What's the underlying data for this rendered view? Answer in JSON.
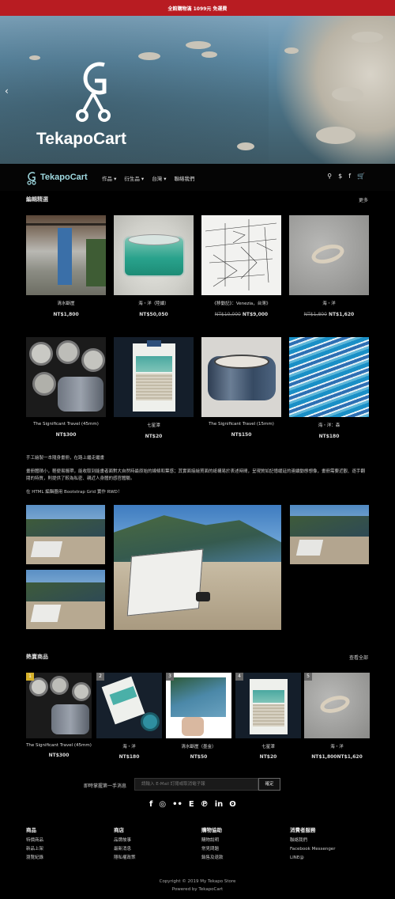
{
  "announcement": "全館購物滿 1099元 免運費",
  "hero": {
    "brand": "TekapoCart",
    "prev": "‹"
  },
  "nav": {
    "brand": "TekapoCart",
    "menu": [
      "作品 ▾",
      "衍生品 ▾",
      "台灣 ▾",
      "聯絡我們"
    ],
    "icons": [
      "search-icon",
      "currency-icon",
      "facebook-icon",
      "cart-icon"
    ]
  },
  "featured": {
    "title": "編輯精選",
    "more": "更多",
    "items": [
      {
        "name": "清水斷崖",
        "price": "NT$1,800",
        "old": ""
      },
      {
        "name": "海・洋（陸續）",
        "price": "NT$50,050",
        "old": ""
      },
      {
        "name": "《移動記》：Venezia，台灣》",
        "price": "NT$9,000",
        "old": "NT$10,000"
      },
      {
        "name": "海・洋",
        "price": "NT$1,620",
        "old": "NT$1,800"
      },
      {
        "name": "The Significant Travel (45mm)",
        "price": "NT$300",
        "old": ""
      },
      {
        "name": "七星潭",
        "price": "NT$20",
        "old": ""
      },
      {
        "name": "The Significant Travel (15mm)",
        "price": "NT$150",
        "old": ""
      },
      {
        "name": "海・洋：森",
        "price": "NT$180",
        "old": ""
      }
    ]
  },
  "story": {
    "title": "手工繪製一本隨身畫冊，在路上繼走繼畫",
    "body": "畫冊體積小，輕便易攜帶，能收取到能畫者面對大自然時最原始的線條和葉感；其實面接繪買面的紙構易於表述時間，呈現質如記憶緩延的連續動態想像，畫冊需要近觀、逐手翻閱的特質，則提供了較為私密、親近人身體的感官體驗。",
    "note": "在 HTML 編輯器用 Bootstrap Grid 實作 RWD！"
  },
  "hot": {
    "title": "熱賣商品",
    "more": "查看全部",
    "items": [
      {
        "rank": "1",
        "name": "The Significant Travel (45mm)",
        "price": "NT$300",
        "old": ""
      },
      {
        "rank": "2",
        "name": "海・洋",
        "price": "NT$180",
        "old": ""
      },
      {
        "rank": "3",
        "name": "清水斷崖（墨金）",
        "price": "NT$50",
        "old": ""
      },
      {
        "rank": "4",
        "name": "七星潭",
        "price": "NT$20",
        "old": ""
      },
      {
        "rank": "5",
        "name": "海・洋",
        "price": "NT$1,620",
        "old": "NT$1,800"
      }
    ]
  },
  "subscribe": {
    "label": "即時掌握第一手消息",
    "placeholder": "請輸入 E-Mail 訂閱或取消電子報",
    "button": "確定"
  },
  "social_icons": [
    "facebook-icon",
    "instagram-icon",
    "flickr-icon",
    "e-icon",
    "pinterest-icon",
    "linkedin-icon",
    "weibo-icon"
  ],
  "footer": {
    "columns": [
      {
        "title": "商品",
        "links": [
          "特價商品",
          "新品上架",
          "瀏覽紀錄"
        ]
      },
      {
        "title": "商店",
        "links": [
          "品牌故事",
          "最新消息",
          "隱私權政策"
        ]
      },
      {
        "title": "購物協助",
        "links": [
          "購物說明",
          "常見問題",
          "銷售及退款"
        ]
      },
      {
        "title": "消費者服務",
        "links": [
          "聯絡我們",
          "Facebook Messenger",
          "LINE@"
        ]
      }
    ],
    "copyright": "Copyright © 2019 My Tekapo Store",
    "powered": "Powered by TekapoCart"
  }
}
